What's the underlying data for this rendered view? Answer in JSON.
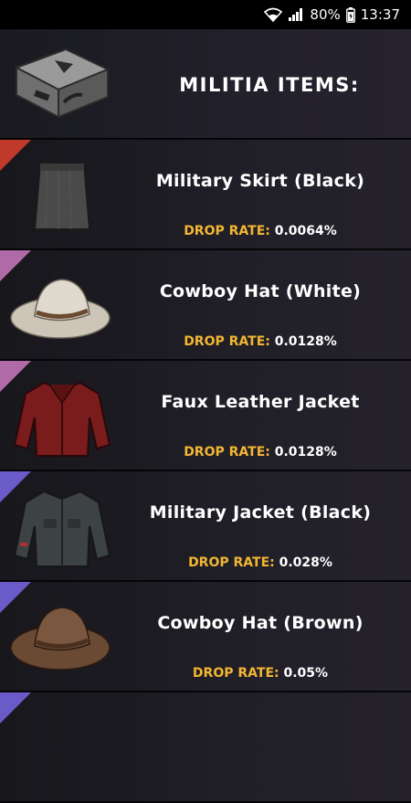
{
  "status": {
    "battery": "80%",
    "time": "13:37"
  },
  "header": {
    "title": "MILITIA ITEMS:"
  },
  "items": [
    {
      "name": "Military Skirt (Black)",
      "rate_label": "DROP RATE:",
      "rate_value": "0.0064%",
      "rarity_color": "#c0392b"
    },
    {
      "name": "Cowboy Hat (White)",
      "rate_label": "DROP RATE:",
      "rate_value": "0.0128%",
      "rarity_color": "#b06aa8"
    },
    {
      "name": "Faux Leather Jacket",
      "rate_label": "DROP RATE:",
      "rate_value": "0.0128%",
      "rarity_color": "#b06aa8"
    },
    {
      "name": "Military Jacket (Black)",
      "rate_label": "DROP RATE:",
      "rate_value": "0.028%",
      "rarity_color": "#6a5bc9"
    },
    {
      "name": "Cowboy Hat (Brown)",
      "rate_label": "DROP RATE:",
      "rate_value": "0.05%",
      "rarity_color": "#6a5bc9"
    },
    {
      "name": "",
      "rate_label": "",
      "rate_value": "",
      "rarity_color": "#6a5bc9"
    }
  ],
  "icons": [
    "wifi-icon",
    "signal-icon",
    "battery-icon",
    "militia-case-icon",
    "skirt-icon",
    "cowboy-hat-white-icon",
    "leather-jacket-icon",
    "military-jacket-icon",
    "cowboy-hat-brown-icon"
  ]
}
